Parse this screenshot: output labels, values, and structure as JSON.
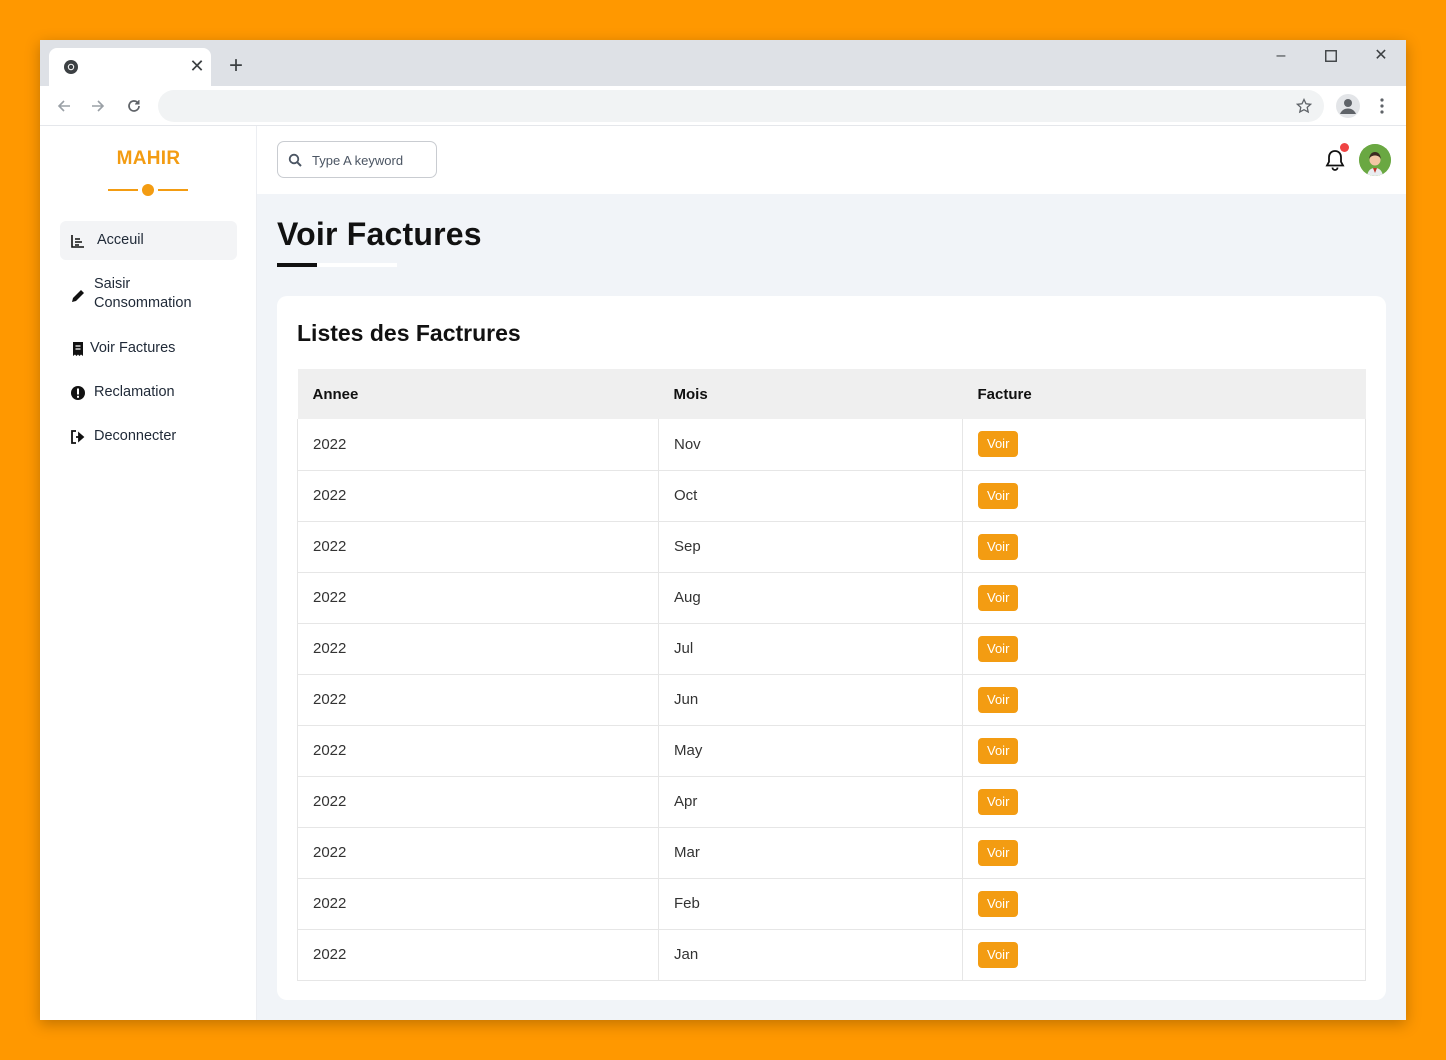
{
  "browser": {
    "tab_close": "✕",
    "new_tab": "+",
    "minimize": "–",
    "close": "✕"
  },
  "sidebar": {
    "brand": "MAHIR",
    "items": [
      {
        "label": "Acceuil",
        "icon": "chart-icon",
        "active": true
      },
      {
        "label": "Saisir Consommation",
        "icon": "pencil-icon",
        "active": false
      },
      {
        "label": "Voir Factures",
        "icon": "receipt-icon",
        "active": false
      },
      {
        "label": "Reclamation",
        "icon": "exclamation-circle-icon",
        "active": false
      },
      {
        "label": "Deconnecter",
        "icon": "sign-out-icon",
        "active": false
      }
    ]
  },
  "topbar": {
    "search_placeholder": "Type A keyword"
  },
  "page": {
    "title": "Voir Factures",
    "card_title": "Listes des Factrures"
  },
  "table": {
    "columns": [
      "Annee",
      "Mois",
      "Facture"
    ],
    "rows": [
      {
        "annee": "2022",
        "mois": "Nov",
        "action": "Voir"
      },
      {
        "annee": "2022",
        "mois": "Oct",
        "action": "Voir"
      },
      {
        "annee": "2022",
        "mois": "Sep",
        "action": "Voir"
      },
      {
        "annee": "2022",
        "mois": "Aug",
        "action": "Voir"
      },
      {
        "annee": "2022",
        "mois": "Jul",
        "action": "Voir"
      },
      {
        "annee": "2022",
        "mois": "Jun",
        "action": "Voir"
      },
      {
        "annee": "2022",
        "mois": "May",
        "action": "Voir"
      },
      {
        "annee": "2022",
        "mois": "Apr",
        "action": "Voir"
      },
      {
        "annee": "2022",
        "mois": "Mar",
        "action": "Voir"
      },
      {
        "annee": "2022",
        "mois": "Feb",
        "action": "Voir"
      },
      {
        "annee": "2022",
        "mois": "Jan",
        "action": "Voir"
      }
    ]
  },
  "colors": {
    "accent": "#f39c12",
    "background": "#ff9800",
    "notification": "#ef4444"
  }
}
